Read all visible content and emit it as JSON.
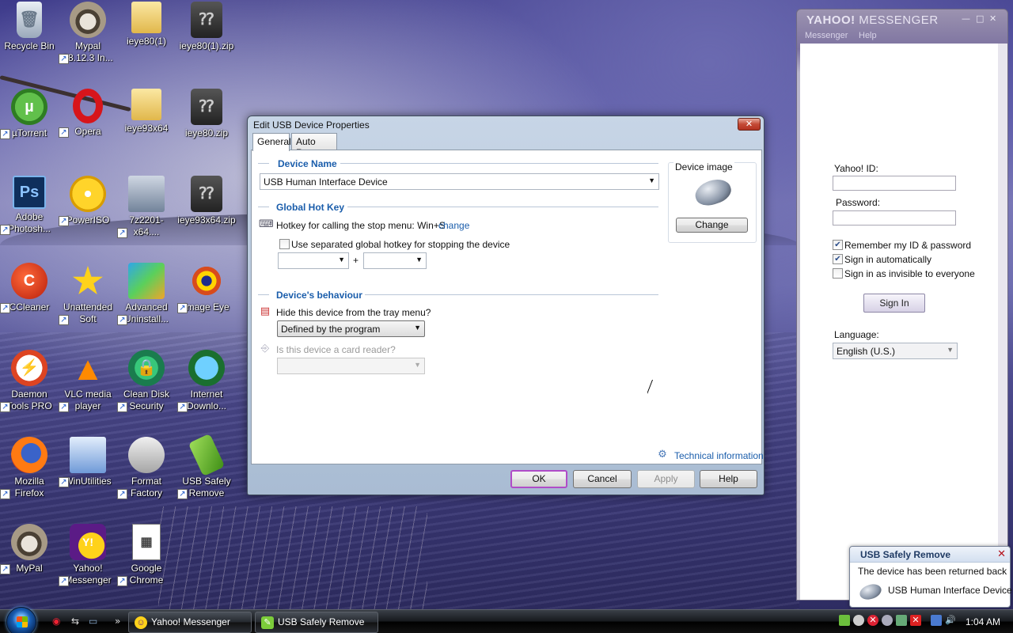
{
  "desktop": {
    "icons": [
      {
        "label": "Recycle Bin",
        "glyph": "🗑",
        "icon": "recycle-bin-icon"
      },
      {
        "label": "Mypal 68.12.3 In...",
        "glyph": "",
        "icon": "raccoon-icon"
      },
      {
        "label": "ieye80(1)",
        "glyph": "",
        "icon": "folder-icon"
      },
      {
        "label": "ieye80(1).zip",
        "glyph": "⁇",
        "icon": "zip-archive-icon"
      },
      {
        "label": "µTorrent",
        "glyph": "µ",
        "icon": "utorrent-icon"
      },
      {
        "label": "Opera",
        "glyph": "",
        "icon": "opera-icon"
      },
      {
        "label": "ieye93x64",
        "glyph": "",
        "icon": "folder-icon"
      },
      {
        "label": "ieye80.zip",
        "glyph": "⁇",
        "icon": "zip-archive-icon"
      },
      {
        "label": "Adobe Photosh...",
        "glyph": "Ps",
        "icon": "photoshop-icon"
      },
      {
        "label": "PowerISO",
        "glyph": "",
        "icon": "disc-icon"
      },
      {
        "label": "7z2201-x64....",
        "glyph": "",
        "icon": "installer-icon"
      },
      {
        "label": "ieye93x64.zip",
        "glyph": "⁇",
        "icon": "zip-archive-icon"
      },
      {
        "label": "CCleaner",
        "glyph": "C",
        "icon": "ccleaner-icon"
      },
      {
        "label": "Unattended Soft",
        "glyph": "★",
        "icon": "star-icon"
      },
      {
        "label": "Advanced Uninstall...",
        "glyph": "",
        "icon": "uninstaller-icon"
      },
      {
        "label": "Image Eye",
        "glyph": "",
        "icon": "eye-icon"
      },
      {
        "label": "Daemon Tools PRO",
        "glyph": "⚡",
        "icon": "daemon-tools-icon"
      },
      {
        "label": "VLC media player",
        "glyph": "▲",
        "icon": "vlc-icon"
      },
      {
        "label": "Clean Disk Security",
        "glyph": "🔒",
        "icon": "clean-disk-icon"
      },
      {
        "label": "Internet Downlo...",
        "glyph": "",
        "icon": "globe-download-icon"
      },
      {
        "label": "Mozilla Firefox",
        "glyph": "",
        "icon": "firefox-icon"
      },
      {
        "label": "WinUtilities",
        "glyph": "",
        "icon": "winutilities-icon"
      },
      {
        "label": "Format Factory",
        "glyph": "",
        "icon": "format-factory-icon"
      },
      {
        "label": "USB Safely Remove",
        "glyph": "",
        "icon": "usb-icon"
      },
      {
        "label": "MyPal",
        "glyph": "",
        "icon": "raccoon-icon"
      },
      {
        "label": "Yahoo! Messenger",
        "glyph": "Y!",
        "icon": "yahoo-messenger-icon"
      },
      {
        "label": "Google Chrome",
        "glyph": "▦",
        "icon": "document-icon"
      }
    ]
  },
  "dialog": {
    "title": "Edit USB Device Properties",
    "close_glyph": "✕",
    "tabs": [
      "General",
      "Auto Run"
    ],
    "device_name": {
      "heading": "Device Name",
      "value": "USB Human Interface Device"
    },
    "hotkey": {
      "heading": "Global Hot Key",
      "label": "Hotkey for calling the stop menu: Win+S",
      "change_link": "change",
      "separate_label": "Use separated global hotkey for stopping the device",
      "separate_checked": false,
      "plus": "+"
    },
    "behaviour": {
      "heading": "Device's behaviour",
      "hide_label": "Hide this device from the tray menu?",
      "hide_value": "Defined by the program",
      "card_reader_label": "Is this device a card reader?",
      "card_reader_value": ""
    },
    "device_image": {
      "label": "Device image",
      "change_button": "Change"
    },
    "tech_info": "Technical information",
    "buttons": {
      "ok": "OK",
      "cancel": "Cancel",
      "apply": "Apply",
      "help": "Help"
    }
  },
  "yahoo": {
    "title_brand": "YAHOO!",
    "title_app": "MESSENGER",
    "menu": [
      "Messenger",
      "Help"
    ],
    "window_controls": [
      "—",
      "□",
      "✕"
    ],
    "id_label": "Yahoo! ID:",
    "id_value": "",
    "password_label": "Password:",
    "password_value": "",
    "remember_label": "Remember my ID & password",
    "remember_checked": true,
    "auto_label": "Sign in automatically",
    "auto_checked": true,
    "invisible_label": "Sign in as invisible to everyone",
    "invisible_checked": false,
    "signin_button": "Sign In",
    "language_label": "Language:",
    "language_value": "English (U.S.)"
  },
  "notification": {
    "title": "USB Safely Remove",
    "message": "The device has been returned back",
    "device": "USB Human Interface Device",
    "close_glyph": "✕"
  },
  "taskbar": {
    "tasks": [
      {
        "label": "Yahoo! Messenger",
        "icon": "yahoo-smiley-icon"
      },
      {
        "label": "USB Safely Remove",
        "icon": "usb-icon"
      }
    ],
    "clock": "1:04 AM",
    "quicklaunch_more": "»"
  }
}
